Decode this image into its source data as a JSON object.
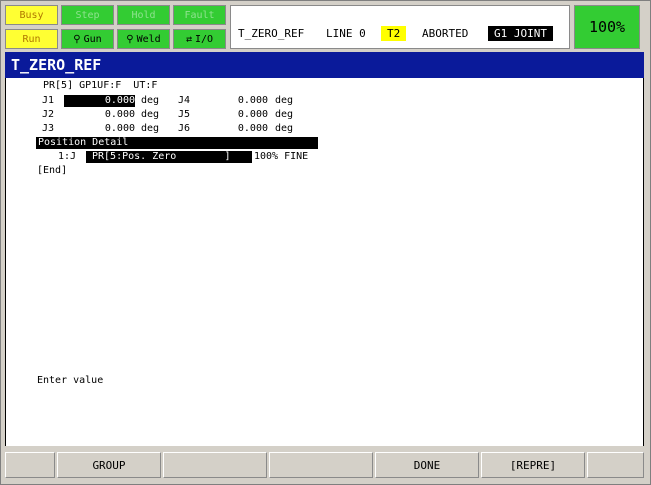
{
  "status_lamps": {
    "busy": "Busy",
    "step": "Step",
    "hold": "Hold",
    "fault": "Fault",
    "run": "Run",
    "gun": "Gun",
    "weld": "Weld",
    "io": "I/O"
  },
  "status_bar": {
    "program": "T_ZERO_REF",
    "line": "LINE 0",
    "mode": "T2",
    "state": "ABORTED",
    "coord": "G1 JOINT"
  },
  "override": "100%",
  "title": "T_ZERO_REF",
  "position": {
    "header": "PR[5] GP1UF:F  UT:F",
    "rows": [
      {
        "a_label": "J1",
        "a_value": "0.000",
        "a_unit": "deg",
        "b_label": "J4",
        "b_value": "0.000",
        "b_unit": "deg"
      },
      {
        "a_label": "J2",
        "a_value": "0.000",
        "a_unit": "deg",
        "b_label": "J5",
        "b_value": "0.000",
        "b_unit": "deg"
      },
      {
        "a_label": "J3",
        "a_value": "0.000",
        "a_unit": "deg",
        "b_label": "J6",
        "b_value": "0.000",
        "b_unit": "deg"
      }
    ],
    "detail_header": "Position Detail",
    "line_number": "1:J",
    "line_target": "PR[5:Pos. Zero        ]",
    "line_suffix": "100% FINE",
    "end_marker": "[End]"
  },
  "prompt": "Enter value",
  "function_keys": [
    "",
    "GROUP",
    "",
    "",
    "DONE",
    "[REPRE]",
    ""
  ]
}
